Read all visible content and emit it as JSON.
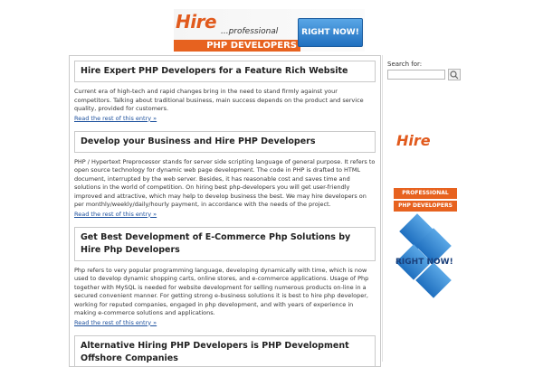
{
  "banner": {
    "hire": "Hire",
    "professional": "...professional",
    "developers": "PHP DEVELOPERS",
    "cta": "RIGHT NOW!"
  },
  "posts": [
    {
      "title": "Hire Expert PHP Developers for a Feature Rich Website",
      "body": "Current era of high-tech and rapid changes bring in the need to stand firmly against your competitors. Talking about traditional business, main success depends on the product and service quality, provided for customers.",
      "read_more": "Read the rest of this entry »"
    },
    {
      "title": "Develop your Business and Hire PHP Developers",
      "body": "PHP / Hypertext Preprocessor stands for server side scripting language of general purpose. It refers to open source technology for dynamic web page development. The code in PHP is drafted to HTML document, interrupted by the web server. Besides, it has reasonable cost and saves time and solutions in the world of competition. On hiring best php-developers you will get user-friendly improved and attractive, which may help to develop business the best. We may hire developers on per monthly/weekly/daily/hourly payment, in accordance with the needs of the project.",
      "read_more": "Read the rest of this entry »"
    },
    {
      "title": "Get Best Development of E-Commerce Php Solutions by Hire Php Developers",
      "body": "Php refers to very popular programming language, developing dynamically with time, which is now used to develop dynamic shopping carts, online stores, and e-commerce applications. Usage of Php together with MySQL is needed for website development for selling numerous products on-line in a secured convenient manner. For getting strong e-business solutions it is best to hire php developer, working for reputed companies, engaged in php development, and with years of experience in making e-commerce solutions and applications.",
      "read_more": "Read the rest of this entry »"
    },
    {
      "title": "Alternative Hiring PHP Developers is PHP Development Offshore Companies",
      "body": "",
      "read_more": ""
    }
  ],
  "sidebar": {
    "search_label": "Search for:",
    "search_value": "",
    "side_banner": {
      "hire": "Hire",
      "professional": "PROFESSIONAL",
      "developers": "PHP DEVELOPERS",
      "cta": "RIGHT NOW!"
    }
  },
  "colors": {
    "accent_orange": "#e7621f",
    "accent_blue": "#1f6fbf",
    "link": "#1a4e9c",
    "border": "#c9c9c9"
  }
}
